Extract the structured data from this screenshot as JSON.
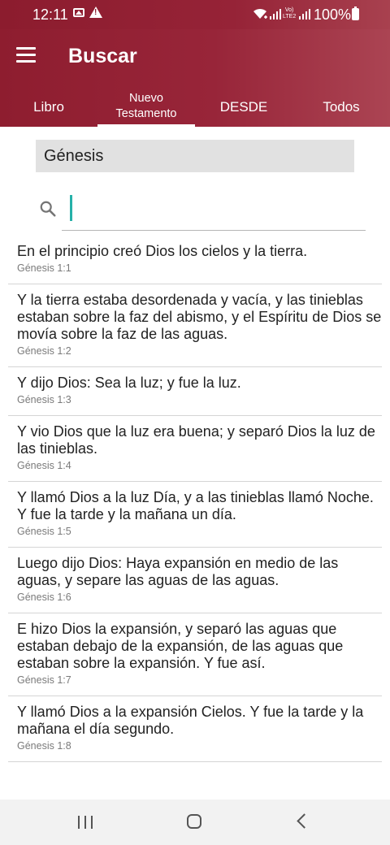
{
  "status_bar": {
    "time": "12:11",
    "battery": "100%",
    "volte_top": "Vo)",
    "volte_bottom": "LTE2"
  },
  "app_bar": {
    "title": "Buscar"
  },
  "tabs": [
    {
      "label": "Libro",
      "active": false
    },
    {
      "label": "Nuevo Testamento",
      "active": true
    },
    {
      "label": "DESDE",
      "active": false
    },
    {
      "label": "Todos",
      "active": false
    }
  ],
  "book_selector": {
    "value": "Génesis"
  },
  "search": {
    "value": "",
    "placeholder": ""
  },
  "results": [
    {
      "text": "En el principio creó Dios los cielos y la tierra.",
      "ref": "Génesis 1:1"
    },
    {
      "text": "Y la tierra estaba desordenada y vacía, y las tinieblas estaban sobre la faz del abismo, y el Espíritu de Dios se movía sobre la faz de las aguas.",
      "ref": "Génesis 1:2"
    },
    {
      "text": "Y dijo Dios: Sea la luz; y fue la luz.",
      "ref": "Génesis 1:3"
    },
    {
      "text": "Y vio Dios que la luz era buena; y separó Dios la luz de las tinieblas.",
      "ref": "Génesis 1:4"
    },
    {
      "text": "Y llamó Dios a la luz Día, y a las tinieblas llamó Noche. Y fue la tarde y la mañana un día.",
      "ref": "Génesis 1:5"
    },
    {
      "text": "Luego dijo Dios: Haya expansión en medio de las aguas, y separe las aguas de las aguas.",
      "ref": "Génesis 1:6"
    },
    {
      "text": "E hizo Dios la expansión, y separó las aguas que estaban debajo de la expansión, de las aguas que estaban sobre la expansión. Y fue así.",
      "ref": "Génesis 1:7"
    },
    {
      "text": "Y llamó Dios a la expansión Cielos. Y fue la tarde y la mañana el día segundo.",
      "ref": "Génesis 1:8"
    }
  ],
  "colors": {
    "app_bar": "#962337",
    "cursor": "#26b1a9",
    "book_bg": "#e1e1e1"
  },
  "icons": {
    "menu": "hamburger-icon",
    "search": "search-icon",
    "recent": "recent-apps-icon",
    "home": "home-icon",
    "back": "back-icon"
  }
}
